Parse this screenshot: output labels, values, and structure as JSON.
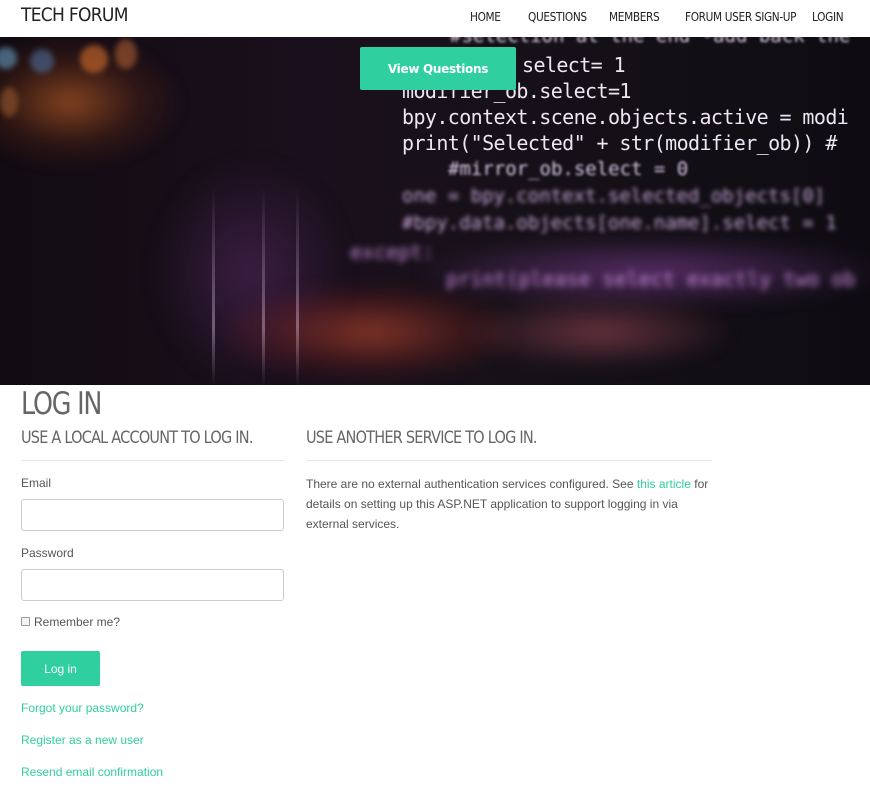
{
  "navbar": {
    "brand": "TECH FORUM",
    "items": [
      {
        "label": "HOME"
      },
      {
        "label": "QUESTIONS"
      },
      {
        "label": "MEMBERS"
      },
      {
        "label": "FORUM USER SIGN-UP"
      },
      {
        "label": "LOGIN"
      }
    ]
  },
  "hero": {
    "button_label": "View Questions",
    "background_code_lines": [
      "#selection at the end -add back the",
      "select= 1",
      "modifier_ob.select=1",
      "bpy.context.scene.objects.active = modi",
      "print(\"Selected\" + str(modifier_ob)) #",
      "#mirror_ob.select = 0",
      "one = bpy.context.selected_objects[0]",
      "#bpy.data.objects[one.name].select = 1",
      "except:",
      "print(please select exactly two ob"
    ]
  },
  "page": {
    "title": "LOG IN"
  },
  "local_login": {
    "heading": "USE A LOCAL ACCOUNT TO LOG IN.",
    "email_label": "Email",
    "email_value": "",
    "password_label": "Password",
    "password_value": "",
    "remember_label": "Remember me?",
    "remember_checked": false,
    "submit_label": "Log in",
    "links": {
      "forgot": "Forgot your password?",
      "register": "Register as a new user",
      "resend": "Resend email confirmation"
    }
  },
  "external_login": {
    "heading": "USE ANOTHER SERVICE TO LOG IN.",
    "text_before": "There are no external authentication services configured. See ",
    "link_text": "this article",
    "text_after": " for details on setting up this ASP.NET application to support logging in via external services."
  },
  "colors": {
    "accent": "#2fcf9f",
    "text": "#555555",
    "heading": "#666666"
  }
}
